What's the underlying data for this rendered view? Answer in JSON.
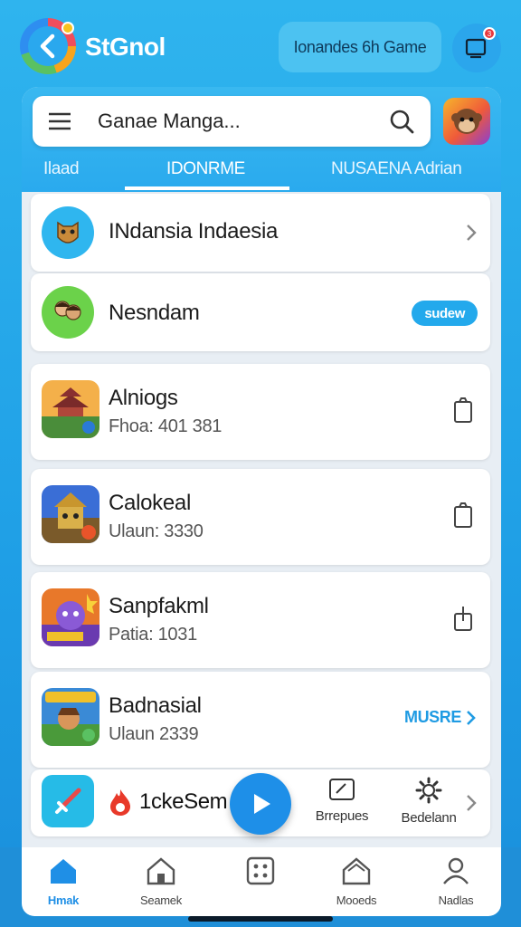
{
  "app": {
    "title": "StGnol",
    "game_pill": "Ionandes 6h Game"
  },
  "search": {
    "value": "Ganae Manga..."
  },
  "tabs": [
    {
      "label": "Ilaad"
    },
    {
      "label": "IDONRME"
    },
    {
      "label": "NUSAENA Adrian"
    }
  ],
  "categories": [
    {
      "label": "INdansia Indaesia"
    },
    {
      "label": "Nesndam",
      "badge": "sudew"
    }
  ],
  "games": [
    {
      "name": "Alniogs",
      "meta": "Fhoa: 401 381"
    },
    {
      "name": "Calokeal",
      "meta": "Ulaun: 3330"
    },
    {
      "name": "Sanpfakml",
      "meta": "Patia: 1031"
    },
    {
      "name": "Badnasial",
      "meta": "Ulaun 2339",
      "link": "MUSRE"
    }
  ],
  "quick": {
    "label": "1ckeSem",
    "actions": [
      {
        "label": "Brrepues",
        "icon": "edit-icon"
      },
      {
        "label": "Bedelann",
        "icon": "gear-icon"
      }
    ]
  },
  "nav": [
    {
      "label": "Hmak",
      "icon": "home-icon",
      "active": true
    },
    {
      "label": "Seamek",
      "icon": "store-icon"
    },
    {
      "label": "",
      "icon": "grid-icon"
    },
    {
      "label": "Mooeds",
      "icon": "building-icon"
    },
    {
      "label": "Nadlas",
      "icon": "user-icon"
    }
  ],
  "colors": {
    "accent": "#1f9be3",
    "background": "#2fb4ee",
    "notification": "#e8383d"
  }
}
